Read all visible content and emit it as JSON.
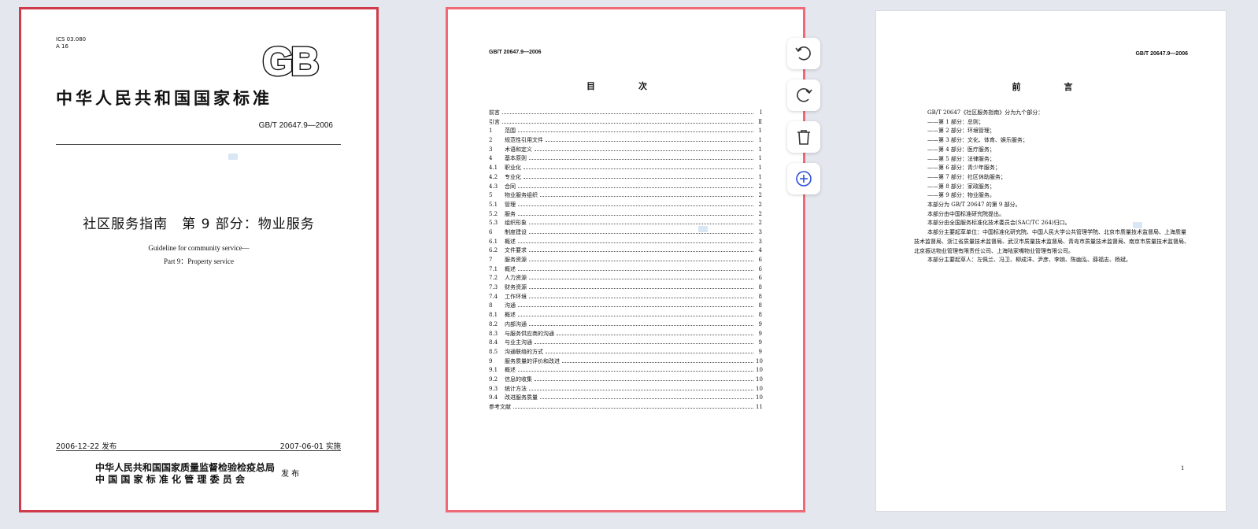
{
  "cover": {
    "ics_line1": "ICS 03.080",
    "ics_line2": "A 16",
    "logo_text": "GB",
    "national_standard": "中华人民共和国国家标准",
    "standard_number": "GB/T 20647.9—2006",
    "title_cn": "社区服务指南　第 9 部分：物业服务",
    "title_en_line1": "Guideline for community service—",
    "title_en_line2": "Part 9：Property service",
    "publish_date": "2006-12-22 发布",
    "implement_date": "2007-06-01 实施",
    "issuer_line1": "中华人民共和国国家质量监督检验检疫总局",
    "issuer_line2": "中 国 国 家 标 准 化 管 理 委 员 会",
    "issue_word": "发 布"
  },
  "toc": {
    "header": "GB/T 20647.9—2006",
    "title": "目　次",
    "entries": [
      {
        "num": "前言",
        "text": "",
        "page": "Ⅰ"
      },
      {
        "num": "引言",
        "text": "",
        "page": "Ⅱ"
      },
      {
        "num": "1",
        "text": "范围",
        "page": "1"
      },
      {
        "num": "2",
        "text": "规范性引用文件",
        "page": "1"
      },
      {
        "num": "3",
        "text": "术语和定义",
        "page": "1"
      },
      {
        "num": "4",
        "text": "基本原则",
        "page": "1"
      },
      {
        "num": "4.1",
        "text": "职业化",
        "page": "1"
      },
      {
        "num": "4.2",
        "text": "专业化",
        "page": "1"
      },
      {
        "num": "4.3",
        "text": "合同",
        "page": "2"
      },
      {
        "num": "5",
        "text": "物业服务组织",
        "page": "2"
      },
      {
        "num": "5.1",
        "text": "管理",
        "page": "2"
      },
      {
        "num": "5.2",
        "text": "服务",
        "page": "2"
      },
      {
        "num": "5.3",
        "text": "组织形象",
        "page": "2"
      },
      {
        "num": "6",
        "text": "制度建设",
        "page": "3"
      },
      {
        "num": "6.1",
        "text": "概述",
        "page": "3"
      },
      {
        "num": "6.2",
        "text": "文件要求",
        "page": "4"
      },
      {
        "num": "7",
        "text": "服务资源",
        "page": "6"
      },
      {
        "num": "7.1",
        "text": "概述",
        "page": "6"
      },
      {
        "num": "7.2",
        "text": "人力资源",
        "page": "6"
      },
      {
        "num": "7.3",
        "text": "财务资源",
        "page": "8"
      },
      {
        "num": "7.4",
        "text": "工作环境",
        "page": "8"
      },
      {
        "num": "8",
        "text": "沟通",
        "page": "8"
      },
      {
        "num": "8.1",
        "text": "概述",
        "page": "8"
      },
      {
        "num": "8.2",
        "text": "内部沟通",
        "page": "9"
      },
      {
        "num": "8.3",
        "text": "与服务供应商的沟通",
        "page": "9"
      },
      {
        "num": "8.4",
        "text": "与业主沟通",
        "page": "9"
      },
      {
        "num": "8.5",
        "text": "沟通联络的方式",
        "page": "9"
      },
      {
        "num": "9",
        "text": "服务质量的评价和改进",
        "page": "10"
      },
      {
        "num": "9.1",
        "text": "概述",
        "page": "10"
      },
      {
        "num": "9.2",
        "text": "信息的收集",
        "page": "10"
      },
      {
        "num": "9.3",
        "text": "统计方法",
        "page": "10"
      },
      {
        "num": "9.4",
        "text": "改进服务质量",
        "page": "10"
      },
      {
        "num": "参考文献",
        "text": "",
        "page": "11"
      }
    ]
  },
  "preface": {
    "header": "GB/T 20647.9—2006",
    "title": "前　言",
    "intro": "GB/T 20647《社区服务指南》分为九个部分：",
    "parts": [
      "——第 1 部分：总则；",
      "——第 2 部分：环境管理；",
      "——第 3 部分：文化、体育、娱乐服务；",
      "——第 4 部分：医疗服务；",
      "——第 5 部分：法律服务；",
      "——第 6 部分：青少年服务；",
      "——第 7 部分：社区休助服务；",
      "——第 8 部分：家政服务；",
      "——第 9 部分：物业服务。"
    ],
    "p1": "本部分为 GB/T 20647 的第 9 部分。",
    "p2": "本部分由中国标准研究院提出。",
    "p3": "本部分由全国服务标准化技术委员会(SAC/TC 264)归口。",
    "p4": "本部分主要起草单位：中国标准化研究院、中国人民大学公共管理学院、北京市质量技术监督局、上海质量技术监督局、浙江省质量技术监督局、武汉市质量技术监督局、青岛市质量技术监督局、南京市质量技术监督局、北京振达物业管理有限责任公司、上海陆家嘴物业管理有限公司。",
    "p5": "本部分主要起草人：左佩兰、冯卫、柳成洋、尹彦、李婉、陈幽泓、薛福志、杨斌。",
    "page_number": "1"
  },
  "toolbar": {
    "rotate_left": "rotate-left-icon",
    "rotate_right": "rotate-right-icon",
    "delete": "trash-icon",
    "insert": "plus-circle-icon"
  },
  "colors": {
    "selected_border": "#cf3b4a",
    "hover_border": "#ee6a76",
    "background": "#e4e7ee"
  }
}
